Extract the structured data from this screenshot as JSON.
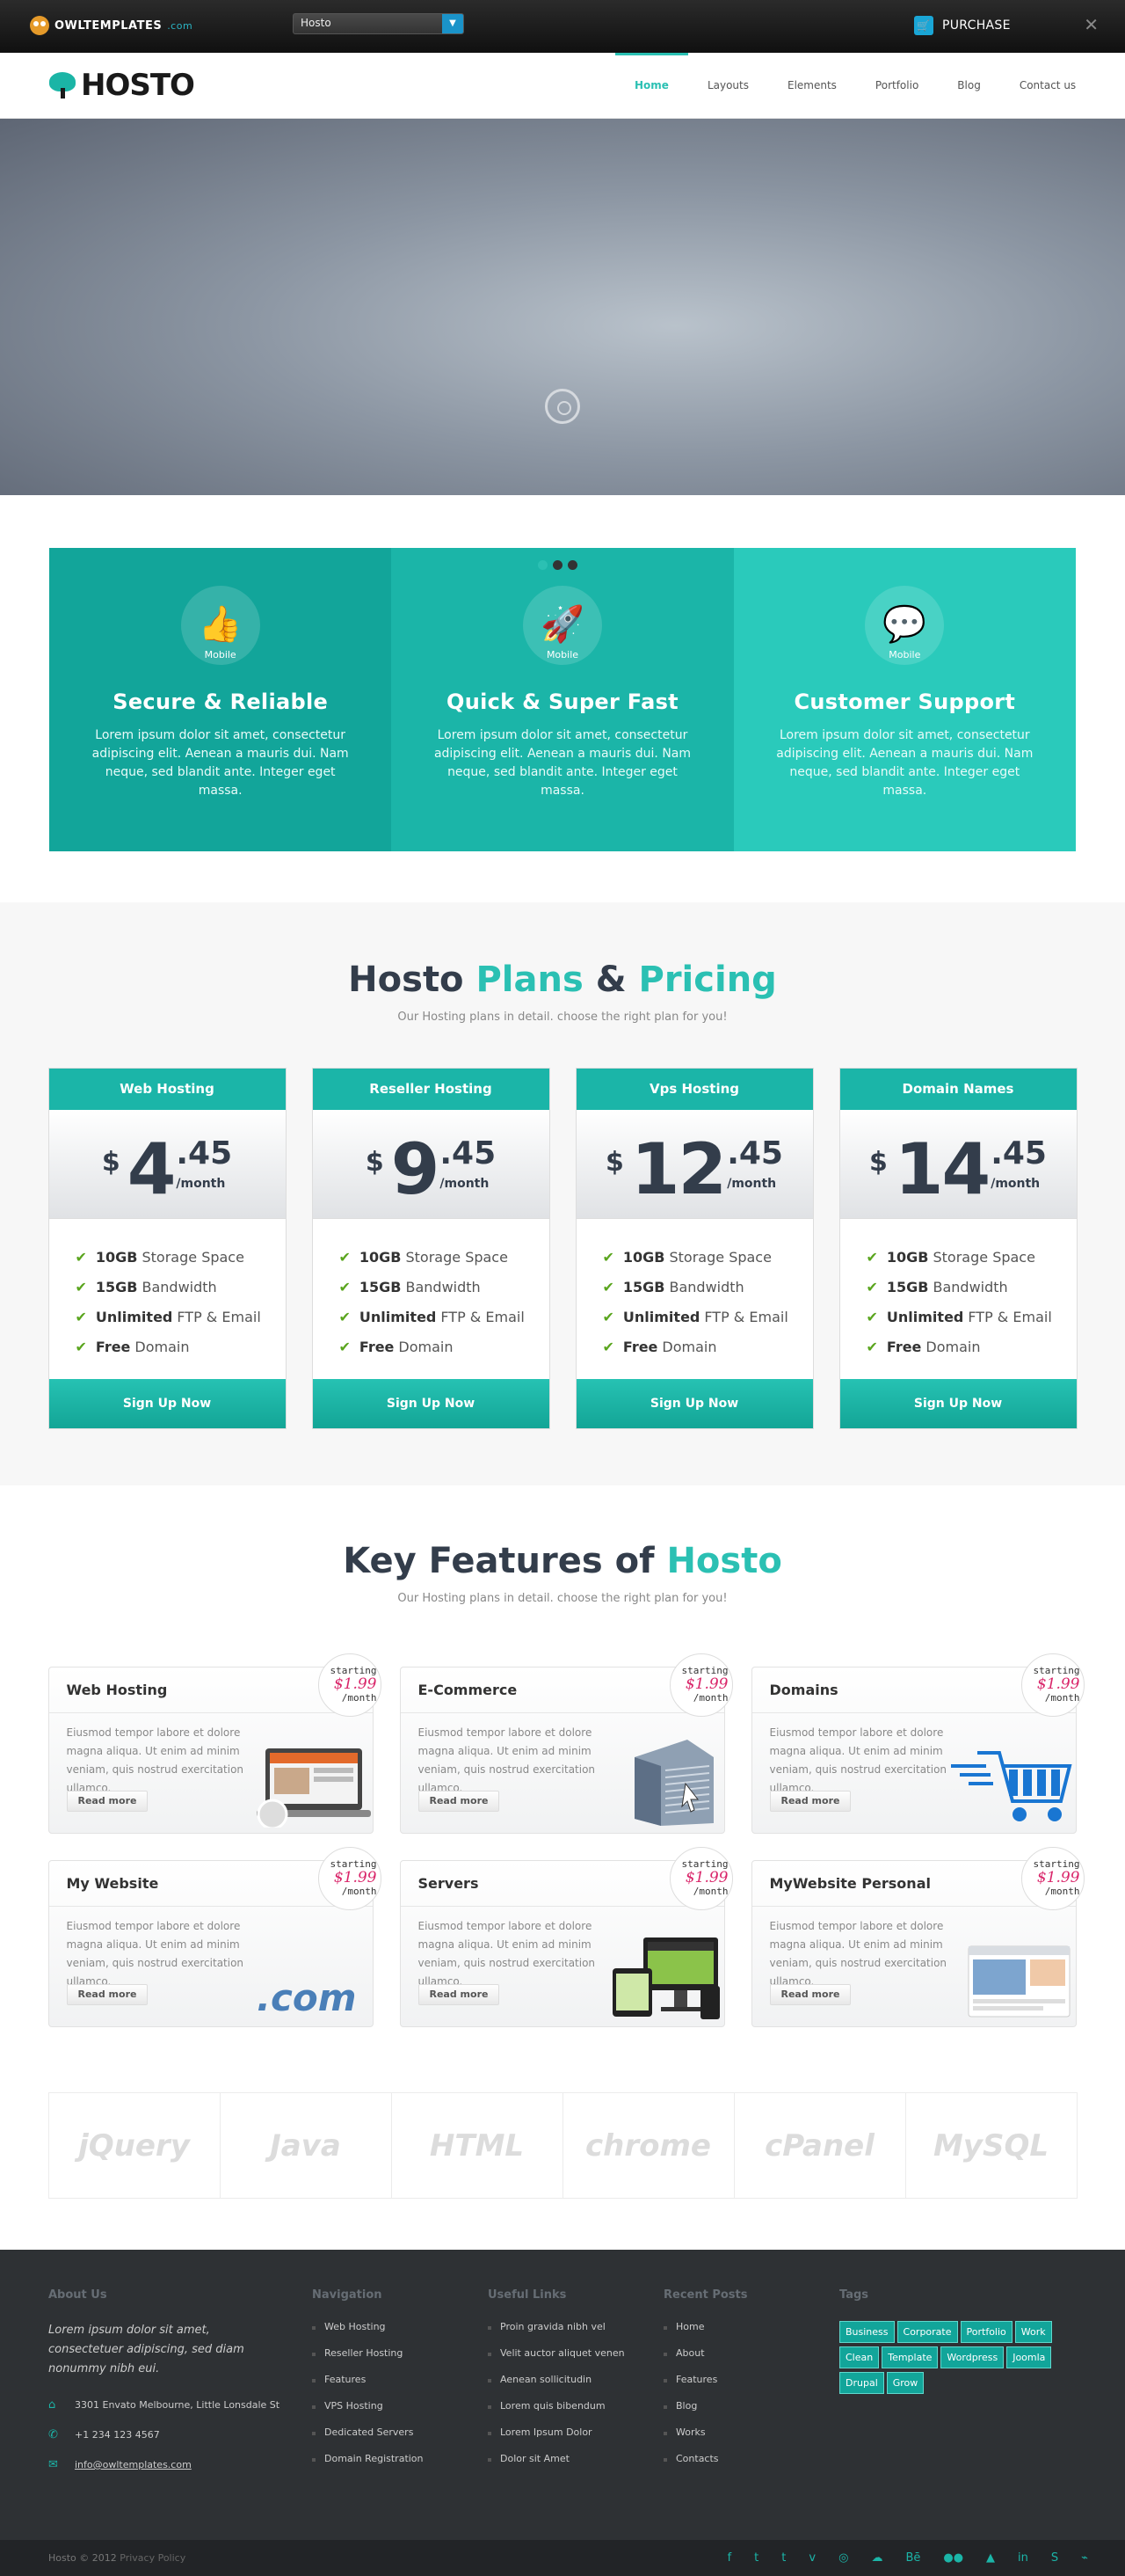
{
  "topbar": {
    "brand": "OWLTEMPLATES",
    "brand_domain": ".com",
    "theme_select": "Hosto",
    "purchase": "PURCHASE",
    "close": "✕"
  },
  "header": {
    "brand": "HOSTO",
    "nav": [
      "Home",
      "Layouts",
      "Elements",
      "Portfolio",
      "Blog",
      "Contact us"
    ],
    "active": "Home"
  },
  "features": [
    {
      "icon": "thumbs-up-icon",
      "glyph": "👍",
      "tag": "Mobile",
      "title": "Secure & Reliable",
      "text": "Lorem ipsum dolor sit amet, consectetur adipiscing elit. Aenean a mauris dui. Nam neque, sed blandit ante. Integer eget massa."
    },
    {
      "icon": "rocket-icon",
      "glyph": "🚀",
      "tag": "Mobile",
      "title": "Quick & Super Fast",
      "text": "Lorem ipsum dolor sit amet, consectetur adipiscing elit. Aenean a mauris dui. Nam neque, sed blandit ante. Integer eget massa."
    },
    {
      "icon": "chat-icon",
      "glyph": "💬",
      "tag": "Mobile",
      "title": "Customer Support",
      "text": "Lorem ipsum dolor sit amet, consectetur adipiscing elit. Aenean a mauris dui. Nam neque, sed blandit ante. Integer eget massa."
    }
  ],
  "pricing": {
    "title_a": "Hosto ",
    "title_b": "Plans",
    " title_c": " & ",
    "title_d": "Pricing",
    "subtitle": "Our Hosting plans in detail. choose the right plan for you!",
    "plans": [
      {
        "name": "Web Hosting",
        "currency": "$",
        "int": "4",
        "cents": ".45",
        "period": "/month",
        "button": "Sign Up Now"
      },
      {
        "name": "Reseller Hosting",
        "currency": "$",
        "int": "9",
        "cents": ".45",
        "period": "/month",
        "button": "Sign Up Now"
      },
      {
        "name": "Vps Hosting",
        "currency": "$",
        "int": "12",
        "cents": ".45",
        "period": "/month",
        "button": "Sign Up Now"
      },
      {
        "name": "Domain Names",
        "currency": "$",
        "int": "14",
        "cents": ".45",
        "period": "/month",
        "button": "Sign Up Now"
      }
    ],
    "features": [
      {
        "b": "10GB",
        "t": "Storage Space"
      },
      {
        "b": "15GB",
        "t": "Bandwidth"
      },
      {
        "b": "Unlimited",
        "t": "FTP & Email"
      },
      {
        "b": "Free",
        "t": "Domain"
      }
    ]
  },
  "keyfeatures": {
    "title_a": "Key Features of ",
    "title_b": "Hosto",
    "subtitle": "Our Hosting plans in detail. choose the right plan for you!",
    "cards": [
      {
        "title": "Web Hosting",
        "pic": "laptop"
      },
      {
        "title": "E-Commerce",
        "pic": "server"
      },
      {
        "title": "Domains",
        "pic": "cart"
      },
      {
        "title": "My Website",
        "pic": "dotcom"
      },
      {
        "title": "Servers",
        "pic": "devices"
      },
      {
        "title": "MyWebsite Personal",
        "pic": "site"
      }
    ],
    "text": "Eiusmod tempor labore et dolore magna aliqua. Ut enim ad minim veniam, quis nostrud exercitation ullamco.",
    "read_more": "Read more",
    "badge_top": "starting",
    "badge_price": "$1.99",
    "badge_period": "/month"
  },
  "brands": [
    "jQuery",
    "Java",
    "HTML",
    "chrome",
    "cPanel",
    "MySQL"
  ],
  "footer": {
    "about_h": "About Us",
    "about_text": "Lorem ipsum dolor sit amet, consectetuer adipiscing, sed diam nonummy nibh eui.",
    "address": "3301 Envato Melbourne, Little Lonsdale St",
    "phone": "+1 234 123 4567",
    "email": "info@owltemplates.com",
    "nav_h": "Navigation",
    "nav": [
      "Web Hosting",
      "Reseller Hosting",
      "Features",
      "VPS Hosting",
      "Dedicated Servers",
      "Domain Registration"
    ],
    "links_h": "Useful Links",
    "links": [
      "Proin gravida nibh vel",
      "Velit auctor aliquet venen",
      "Aenean sollicitudin",
      "Lorem quis bibendum",
      "Lorem Ipsum Dolor",
      "Dolor sit Amet"
    ],
    "posts_h": "Recent Posts",
    "posts": [
      "Home",
      "About",
      "Features",
      "Blog",
      "Works",
      "Contacts"
    ],
    "tags_h": "Tags",
    "tags": [
      "Business",
      "Corporate",
      "Portfolio",
      "Work",
      "Clean",
      "Template",
      "Wordpress",
      "Joomla",
      "Drupal",
      "Grow"
    ],
    "copyright": "Hosto © 2012",
    "privacy": "Privacy Policy",
    "social": [
      "facebook-icon",
      "twitter-icon",
      "tumblr-icon",
      "vimeo-icon",
      "dribbble-icon",
      "soundcloud-icon",
      "behance-icon",
      "flickr-icon",
      "forrst-icon",
      "linkedin-icon",
      "skype-icon",
      "rss-icon"
    ],
    "social_glyphs": [
      "f",
      "t",
      "t",
      "v",
      "◎",
      "☁",
      "Bē",
      "●●",
      "▲",
      "in",
      "S",
      "⌁"
    ]
  },
  "colors": {
    "accent": "#2bc0b3",
    "accent_dark": "#12a59a",
    "price_red": "#d9266a"
  }
}
